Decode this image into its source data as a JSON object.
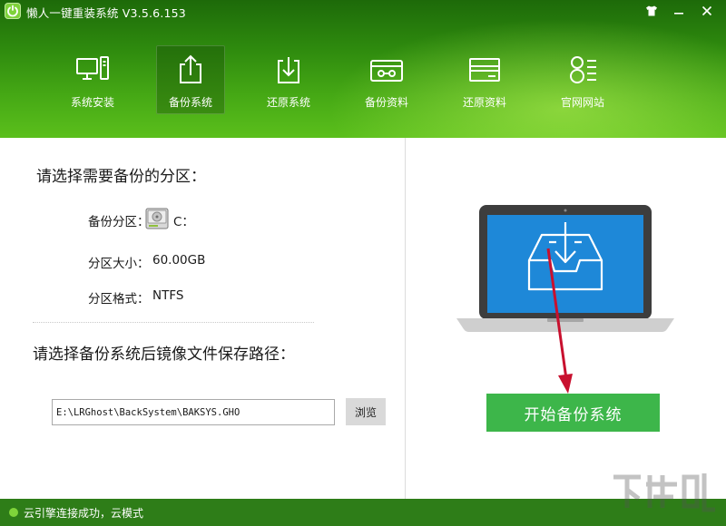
{
  "window": {
    "title": "懒人一键重装系统 V3.5.6.153",
    "controls": [
      "shirt-icon",
      "minimize-icon",
      "close-icon"
    ]
  },
  "nav": {
    "items": [
      {
        "label": "系统安装",
        "icon": "computer-icon",
        "active": false
      },
      {
        "label": "备份系统",
        "icon": "upload-icon",
        "active": true
      },
      {
        "label": "还原系统",
        "icon": "download-icon",
        "active": false
      },
      {
        "label": "备份资料",
        "icon": "drive-icon",
        "active": false
      },
      {
        "label": "还原资料",
        "icon": "card-icon",
        "active": false
      },
      {
        "label": "官网网站",
        "icon": "user-list-icon",
        "active": false
      }
    ]
  },
  "backup": {
    "partition_heading": "请选择需要备份的分区：",
    "partition_label": "备份分区：",
    "partition_value": "C：",
    "size_label": "分区大小：",
    "size_value": "60.00GB",
    "format_label": "分区格式：",
    "format_value": "NTFS",
    "path_heading": "请选择备份系统后镜像文件保存路径：",
    "path_value": "E:\\LRGhost\\BackSystem\\BAKSYS.GHO",
    "browse_label": "浏览",
    "start_label": "开始备份系统"
  },
  "status": {
    "text": "云引擎连接成功，云模式"
  },
  "colors": {
    "header_dark": "#1d6a09",
    "header_light": "#5bbf1c",
    "button_green": "#3db64a",
    "status_green": "#2e7d18",
    "laptop_screen": "#1e88d8",
    "arrow_red": "#c8102e"
  }
}
